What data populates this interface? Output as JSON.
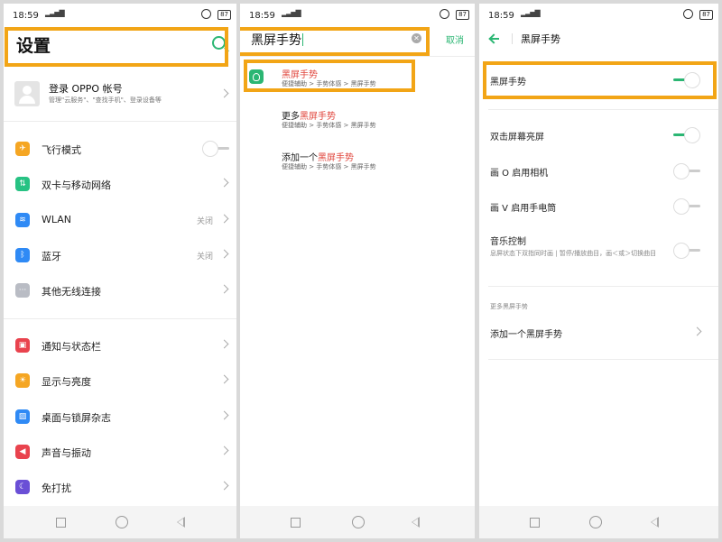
{
  "status": {
    "time": "18:59",
    "battery": "87"
  },
  "screen1": {
    "title": "设置",
    "account": {
      "title": "登录 OPPO 帐号",
      "subtitle": "管理\"云服务\"、\"查找手机\"、登录设备等"
    },
    "items": [
      {
        "label": "飞行模式",
        "value": ""
      },
      {
        "label": "双卡与移动网络",
        "value": ""
      },
      {
        "label": "WLAN",
        "value": "关闭"
      },
      {
        "label": "蓝牙",
        "value": "关闭"
      },
      {
        "label": "其他无线连接",
        "value": ""
      },
      {
        "label": "通知与状态栏",
        "value": ""
      },
      {
        "label": "显示与亮度",
        "value": ""
      },
      {
        "label": "桌面与锁屏杂志",
        "value": ""
      },
      {
        "label": "声音与振动",
        "value": ""
      },
      {
        "label": "免打扰",
        "value": ""
      }
    ]
  },
  "screen2": {
    "query": "黑屏手势",
    "cancel": "取消",
    "results": [
      {
        "prefix": "",
        "highlight": "黑屏手势",
        "path": "便捷辅助 > 手势体感 > 黑屏手势"
      },
      {
        "prefix": "更多",
        "highlight": "黑屏手势",
        "path": "便捷辅助 > 手势体感 > 黑屏手势"
      },
      {
        "prefix": "添加一个",
        "highlight": "黑屏手势",
        "path": "便捷辅助 > 手势体感 > 黑屏手势"
      }
    ]
  },
  "screen3": {
    "title": "黑屏手势",
    "main_toggle": {
      "label": "黑屏手势",
      "on": true
    },
    "options": [
      {
        "label": "双击屏幕亮屏",
        "on": true
      },
      {
        "label": "画 O 启用相机",
        "on": false
      },
      {
        "label": "画 V 启用手电筒",
        "on": false
      },
      {
        "label": "音乐控制",
        "on": false
      }
    ],
    "music_desc": "息屏状态下双指同时画 | 暂停/播放曲目，画＜或＞切换曲目",
    "section_title": "更多黑屏手势",
    "add_gesture": "添加一个黑屏手势"
  }
}
